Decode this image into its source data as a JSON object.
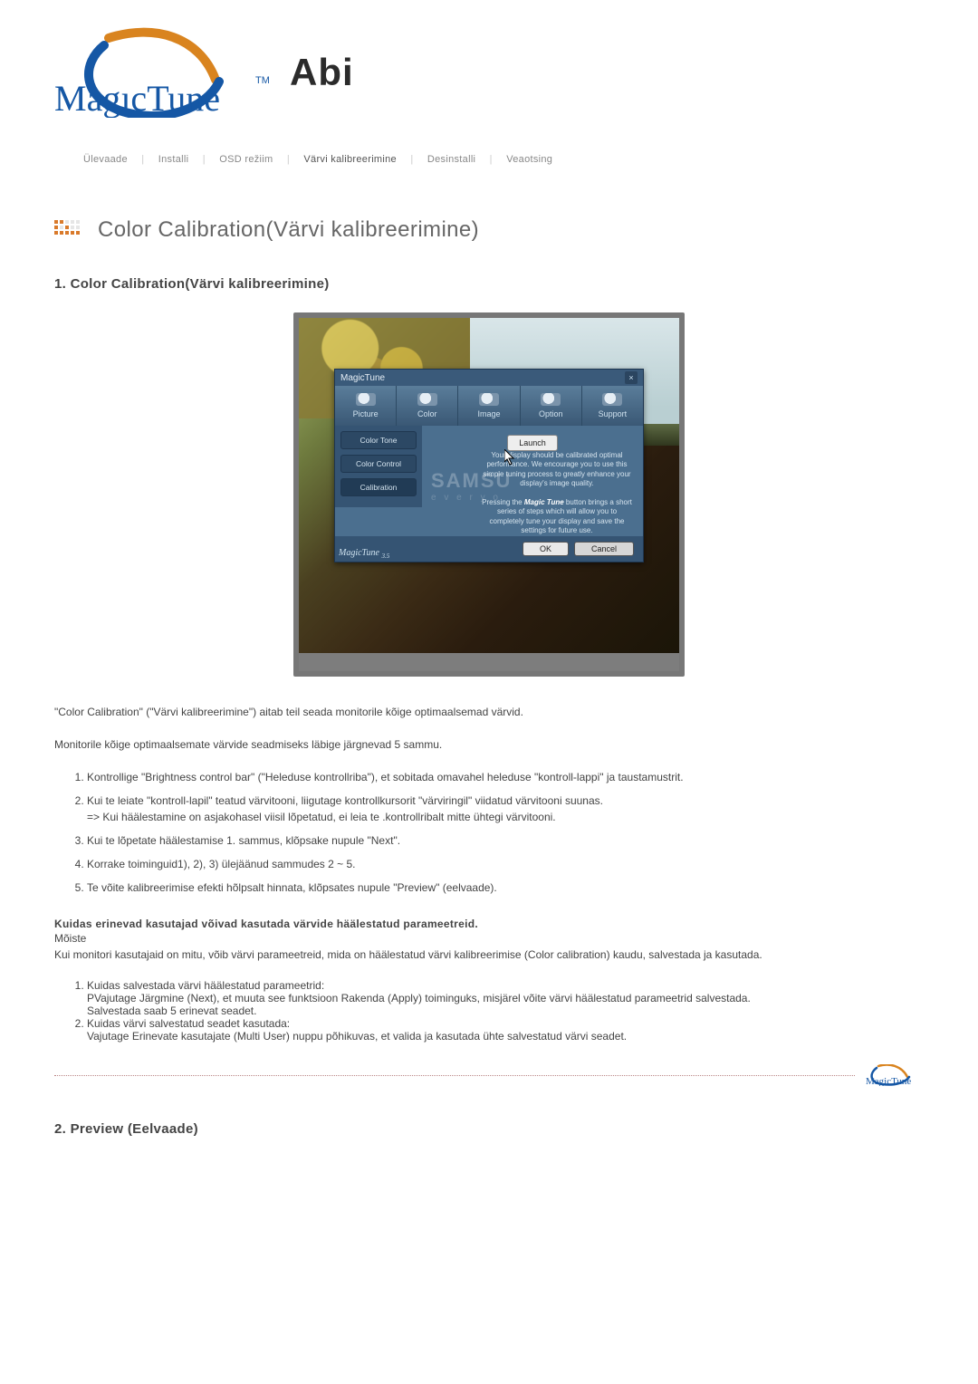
{
  "logo": {
    "brand": "MagıcTune",
    "tm": "TM",
    "suffix": "Abi"
  },
  "nav": {
    "items": [
      "Ülevaade",
      "Installi",
      "OSD režiim",
      "Värvi kalibreerimine",
      "Desinstalli",
      "Veaotsing"
    ],
    "activeIndex": 3,
    "separator": "|"
  },
  "heading": "Color Calibration(Värvi kalibreerimine)",
  "section1": {
    "title": "1. Color Calibration(Värvi kalibreerimine)",
    "app": {
      "title": "MagicTune",
      "tabs": [
        "Picture",
        "Color",
        "Image",
        "Option",
        "Support"
      ],
      "side": [
        "Color Tone",
        "Color Control",
        "Calibration"
      ],
      "launch": "Launch",
      "desc1": "Your display should be calibrated optimal performance. We encourage you to use this simple tuning process to greatly enhance your display's image quality.",
      "desc2_a": "Pressing the ",
      "desc2_b": "Magic Tune",
      "desc2_c": " button brings a short series of steps which will allow you to completely tune your display and save the settings for future use.",
      "ghost1": "SAMSU",
      "ghost2": "e v e r y o",
      "ok": "OK",
      "cancel": "Cancel",
      "corner": "MagicTune",
      "corner_sub": "3.5"
    },
    "p1": "\"Color Calibration\" (\"Värvi kalibreerimine\") aitab teil seada monitorile kõige optimaalsemad värvid.",
    "p2": "Monitorile kõige optimaalsemate värvide seadmiseks läbige järgnevad 5 sammu.",
    "steps": [
      "Kontrollige \"Brightness control bar\" (\"Heleduse kontrollriba\"), et sobitada omavahel heleduse \"kontroll-lappi\" ja taustamustrit.",
      "Kui te leiate \"kontroll-lapil\" teatud värvitooni, liigutage kontrollkursorit \"värviringil\" viidatud värvitooni suunas.",
      "Kui te lõpetate häälestamise 1. sammus, klõpsake nupule \"Next\".",
      "Korrake toiminguid1), 2), 3) ülejäänud sammudes 2 ~ 5.",
      "Te võite kalibreerimise efekti hõlpsalt hinnata, klõpsates nupule \"Preview\" (eelvaade)."
    ],
    "step2_sub": "=> Kui häälestamine on asjakohasel viisil lõpetatud, ei leia te .kontrollribalt mitte ühtegi värvitooni.",
    "bold": "Kuidas erinevad kasutajad võivad kasutada värvide häälestatud parameetreid.",
    "moiste": "Mõiste",
    "moiste_text": "Kui monitori kasutajaid on mitu, võib värvi parameetreid, mida on häälestatud värvi kalibreerimise (Color calibration) kaudu, salvestada ja kasutada.",
    "howto": [
      {
        "title": "Kuidas salvestada värvi häälestatud parameetrid:",
        "lines": [
          "PVajutage Järgmine (Next), et muuta see funktsioon Rakenda (Apply) toiminguks, misjärel võite värvi häälestatud parameetrid salvestada.",
          "Salvestada saab 5 erinevat seadet."
        ]
      },
      {
        "title": "Kuidas värvi salvestatud seadet kasutada:",
        "lines": [
          "Vajutage Erinevate kasutajate (Multi User) nuppu põhikuvas, et valida ja kasutada ühte salvestatud värvi seadet."
        ]
      }
    ]
  },
  "logoSmall": "MagicTune",
  "section2": {
    "title": "2. Preview (Eelvaade)"
  }
}
